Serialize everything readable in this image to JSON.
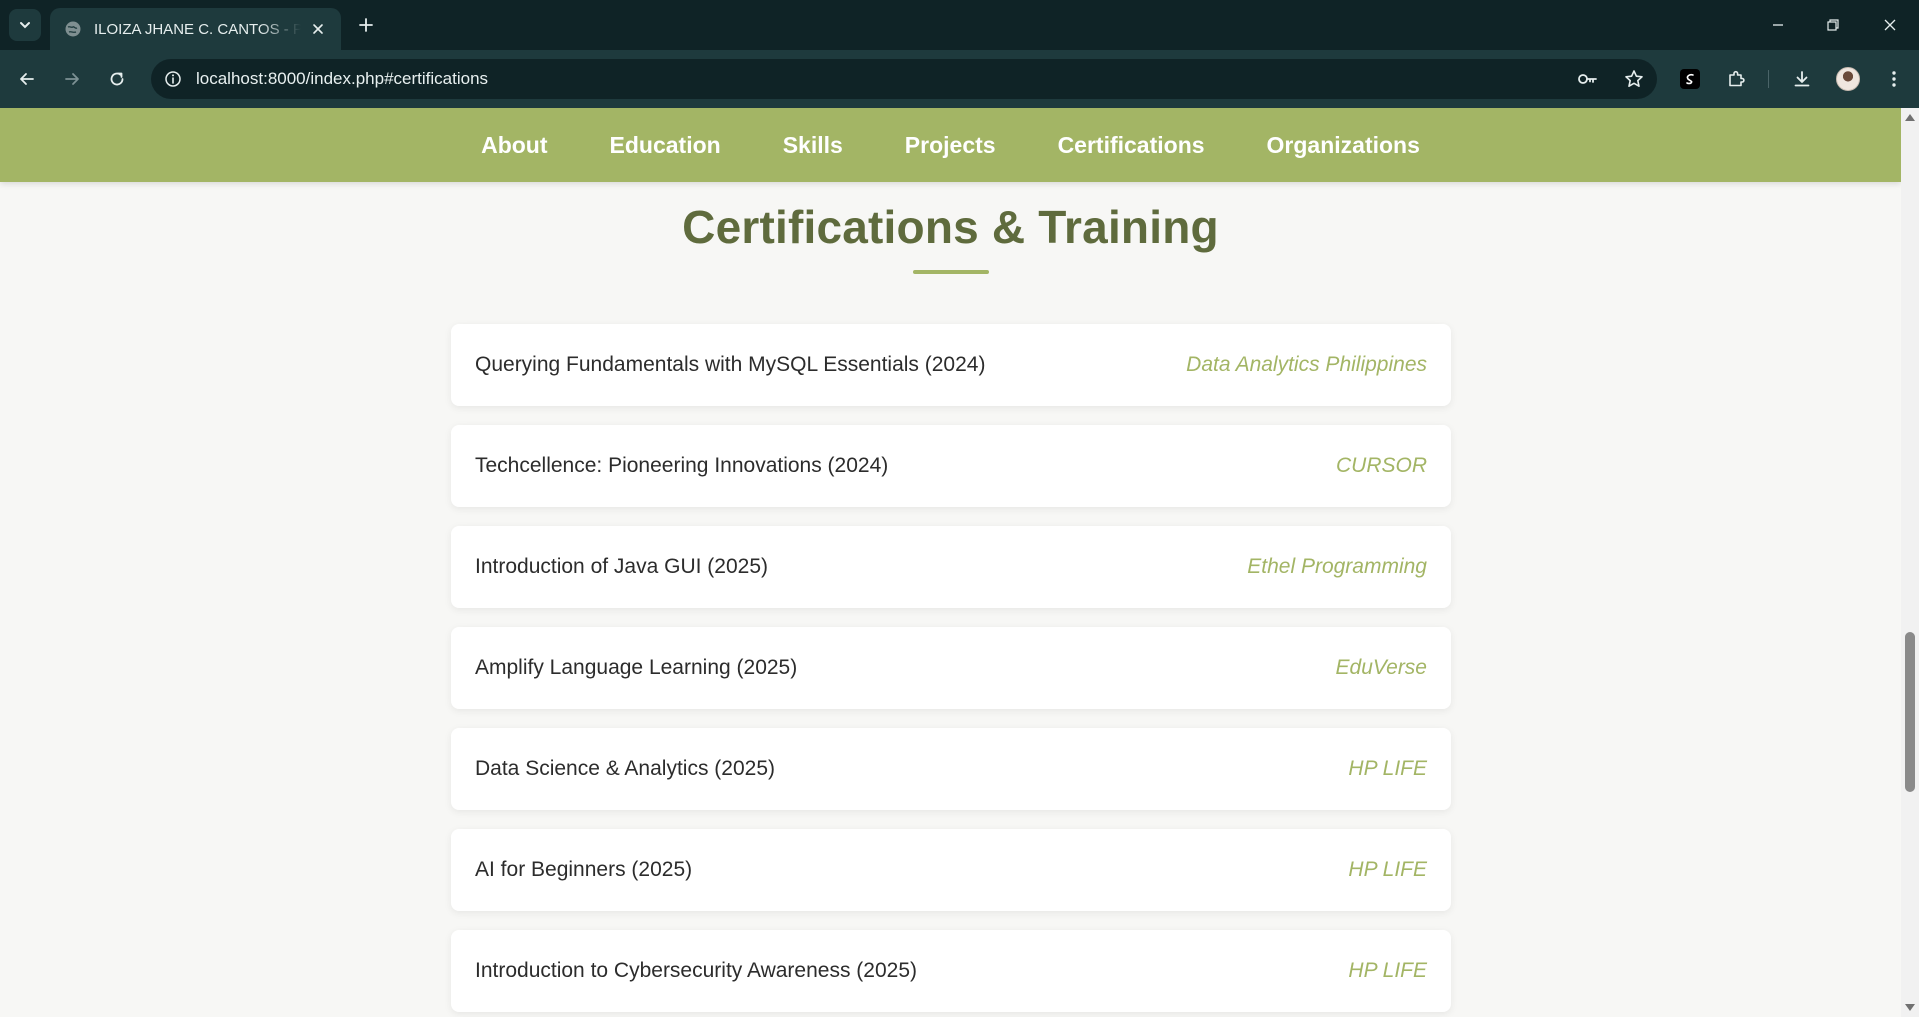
{
  "browser": {
    "tab_title": "ILOIZA JHANE C. CANTOS - Portfolio",
    "url": "localhost:8000/index.php#certifications"
  },
  "site_nav": {
    "items": [
      "About",
      "Education",
      "Skills",
      "Projects",
      "Certifications",
      "Organizations"
    ]
  },
  "section": {
    "title": "Certifications & Training"
  },
  "certifications": [
    {
      "name": "Querying Fundamentals with MySQL Essentials (2024)",
      "issuer": "Data Analytics Philippines"
    },
    {
      "name": "Techcellence: Pioneering Innovations (2024)",
      "issuer": "CURSOR"
    },
    {
      "name": "Introduction of Java GUI (2025)",
      "issuer": "Ethel Programming"
    },
    {
      "name": "Amplify Language Learning (2025)",
      "issuer": "EduVerse"
    },
    {
      "name": "Data Science & Analytics (2025)",
      "issuer": "HP LIFE"
    },
    {
      "name": "AI for Beginners (2025)",
      "issuer": "HP LIFE"
    },
    {
      "name": "Introduction to Cybersecurity Awareness (2025)",
      "issuer": "HP LIFE"
    }
  ],
  "colors": {
    "nav_bg": "#a3b565",
    "title": "#5f6b3d",
    "issuer": "#a3b565",
    "chrome_dark": "#0f2326",
    "chrome_toolbar": "#1e3a3d"
  }
}
